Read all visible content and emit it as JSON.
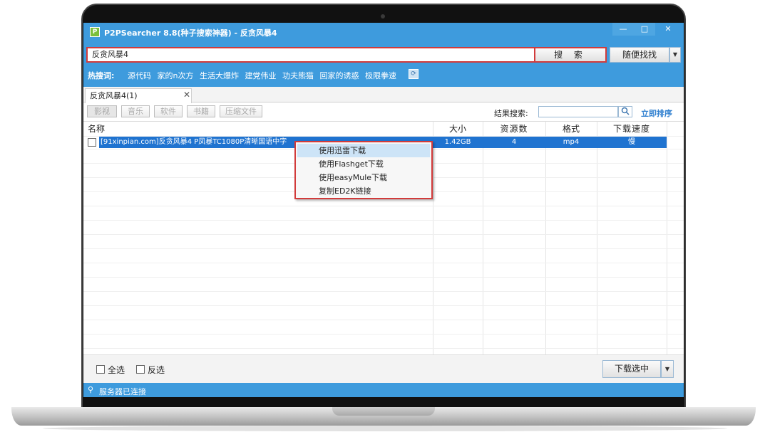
{
  "window": {
    "title": "P2PSearcher 8.8(种子搜索神器) - 反贪风暴4",
    "app_icon": "P",
    "minimize": "—",
    "maximize": "□",
    "close": "✕"
  },
  "search": {
    "value": "反贪风暴4",
    "search_button": "搜 索",
    "random_button": "随便找找",
    "random_dropdown": "▼"
  },
  "hot": {
    "label": "热搜词:",
    "items": [
      "源代码",
      "家的n次方",
      "生活大爆炸",
      "建党伟业",
      "功夫熊猫",
      "回家的诱惑",
      "极限拳速"
    ],
    "refresh_icon": "⟳"
  },
  "tabs": [
    {
      "label": "反贪风暴4(1)",
      "close": "✕"
    }
  ],
  "filters": {
    "categories": [
      "影视",
      "音乐",
      "软件",
      "书籍",
      "压缩文件"
    ],
    "result_search_label": "结果搜索:",
    "result_search_icon": "🔍",
    "sort_link": "立即排序"
  },
  "table": {
    "columns": [
      "名称",
      "大小",
      "资源数",
      "格式",
      "下载速度"
    ],
    "rows": [
      {
        "name": "[91xinpian.com]反贪风暴4 P凤暴TC1080P清晰国语中字",
        "size": "1.42GB",
        "sources": "4",
        "format": "mp4",
        "speed": "慢"
      }
    ]
  },
  "context_menu": {
    "items": [
      "使用迅雷下载",
      "使用Flashget下载",
      "使用easyMule下载",
      "复制ED2K链接"
    ]
  },
  "bottom": {
    "select_all": "全选",
    "invert": "反选",
    "download_button": "下载选中",
    "download_dropdown": "▼"
  },
  "status": {
    "icon": "⚲",
    "text": "服务器已连接"
  },
  "colors": {
    "accent": "#3e9bdd",
    "highlight_border": "#d23b3b",
    "selection": "#1f73d0"
  }
}
